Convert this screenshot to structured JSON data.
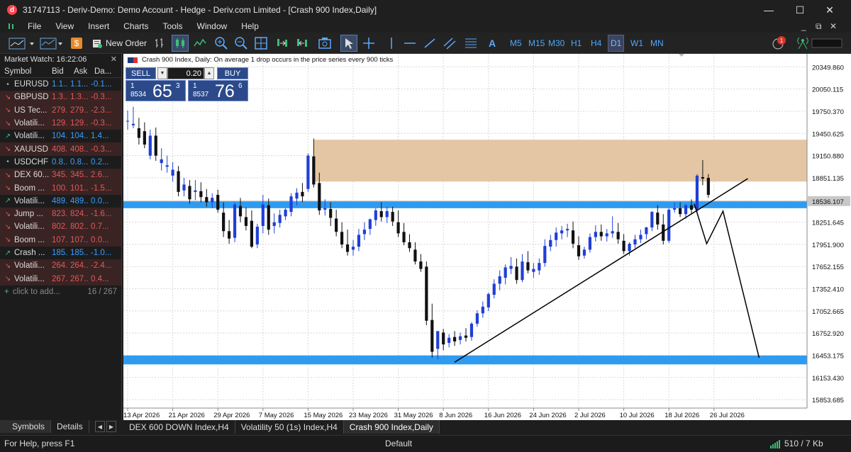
{
  "window": {
    "app_icon": "d",
    "title": "31747113 - Deriv-Demo: Demo Account - Hedge - Deriv.com Limited - [Crash 900 Index,Daily]",
    "minimize": "—",
    "maximize": "☐",
    "close": "✕"
  },
  "menu": {
    "items": [
      "File",
      "View",
      "Insert",
      "Charts",
      "Tools",
      "Window",
      "Help"
    ],
    "right_minimize": "_",
    "right_restore": "⧉",
    "right_close": "✕"
  },
  "toolbar": {
    "new_order": "New Order",
    "timeframes": [
      "M5",
      "M15",
      "M30",
      "H1",
      "H4",
      "D1",
      "W1",
      "MN"
    ],
    "active_timeframe": "D1",
    "notification_count": "1"
  },
  "market_watch": {
    "title": "Market Watch: 16:22:06",
    "close": "✕",
    "headers": {
      "symbol": "Symbol",
      "bid": "Bid",
      "ask": "Ask",
      "daily": "Da..."
    },
    "rows": [
      {
        "symbol": "EURUSD",
        "bid": "1.1...",
        "ask": "1.1...",
        "daily": "-0.1...",
        "trend": "flat"
      },
      {
        "symbol": "GBPUSD",
        "bid": "1.3...",
        "ask": "1.3...",
        "daily": "-0.3...",
        "trend": "down"
      },
      {
        "symbol": "US Tec...",
        "bid": "279...",
        "ask": "279...",
        "daily": "-2.3...",
        "trend": "down"
      },
      {
        "symbol": "Volatili...",
        "bid": "129...",
        "ask": "129...",
        "daily": "-0.3...",
        "trend": "down"
      },
      {
        "symbol": "Volatili...",
        "bid": "104...",
        "ask": "104...",
        "daily": "1.4...",
        "trend": "up"
      },
      {
        "symbol": "XAUUSD",
        "bid": "408...",
        "ask": "408...",
        "daily": "-0.3...",
        "trend": "down"
      },
      {
        "symbol": "USDCHF",
        "bid": "0.8...",
        "ask": "0.8...",
        "daily": "0.2...",
        "trend": "flat"
      },
      {
        "symbol": "DEX 60...",
        "bid": "345...",
        "ask": "345...",
        "daily": "2.6...",
        "trend": "down"
      },
      {
        "symbol": "Boom ...",
        "bid": "100...",
        "ask": "101...",
        "daily": "-1.5...",
        "trend": "down"
      },
      {
        "symbol": "Volatili...",
        "bid": "489...",
        "ask": "489...",
        "daily": "0.0...",
        "trend": "up"
      },
      {
        "symbol": "Jump ...",
        "bid": "823...",
        "ask": "824...",
        "daily": "-1.6...",
        "trend": "down"
      },
      {
        "symbol": "Volatili...",
        "bid": "802...",
        "ask": "802...",
        "daily": "0.7...",
        "trend": "down"
      },
      {
        "symbol": "Boom ...",
        "bid": "107...",
        "ask": "107...",
        "daily": "0.0...",
        "trend": "down"
      },
      {
        "symbol": "Crash ...",
        "bid": "185...",
        "ask": "185...",
        "daily": "-1.0...",
        "trend": "up"
      },
      {
        "symbol": "Volatili...",
        "bid": "264...",
        "ask": "264...",
        "daily": "-2.4...",
        "trend": "down"
      },
      {
        "symbol": "Volatili...",
        "bid": "267...",
        "ask": "267...",
        "daily": "0.4...",
        "trend": "down"
      }
    ],
    "add_label": "click to add...",
    "count": "16 / 267",
    "tabs": [
      "Symbols",
      "Details"
    ]
  },
  "one_click": {
    "sell_label": "SELL",
    "buy_label": "BUY",
    "lot": "0.20",
    "sell_price": {
      "prefix_top": "1",
      "prefix_bottom": "8534",
      "big": "65",
      "sup": "3"
    },
    "buy_price": {
      "prefix_top": "1",
      "prefix_bottom": "8537",
      "big": "76",
      "sup": "6"
    }
  },
  "chart_tabs": [
    "DEX 600 DOWN Index,H4",
    "Volatility 50 (1s) Index,H4",
    "Crash 900 Index,Daily"
  ],
  "active_chart_tab": "Crash 900 Index,Daily",
  "chart_data": {
    "type": "candlestick",
    "title": "Crash 900 Index, Daily:  On average 1 drop occurs in the price series every 900 ticks",
    "y_ticks": [
      "20349.860",
      "20050.115",
      "19750.370",
      "19450.625",
      "19150.880",
      "18851.135",
      "18536.107",
      "18251.645",
      "17951.900",
      "17652.155",
      "17352.410",
      "17052.665",
      "16752.920",
      "16453.175",
      "16153.430",
      "15853.685"
    ],
    "y_tick_values": [
      20349.86,
      20050.115,
      19750.37,
      19450.625,
      19150.88,
      18851.135,
      18536.107,
      18251.645,
      17951.9,
      17652.155,
      17352.41,
      17052.665,
      16752.92,
      16453.175,
      16153.43,
      15853.685
    ],
    "ylim": [
      15740,
      20525
    ],
    "current_price": 18536.107,
    "x_ticks": [
      "13 Apr 2026",
      "21 Apr 2026",
      "29 Apr 2026",
      "7 May 2026",
      "15 May 2026",
      "23 May 2026",
      "31 May 2026",
      "8 Jun 2026",
      "16 Jun 2026",
      "24 Jun 2026",
      "2 Jul 2026",
      "10 Jul 2026",
      "18 Jul 2026",
      "26 Jul 2026"
    ],
    "x_tick_day_index": [
      0,
      8,
      16,
      24,
      32,
      40,
      48,
      56,
      64,
      72,
      80,
      88,
      96,
      104
    ],
    "x_days_total": 120,
    "grid": true,
    "colors": {
      "bull": "#1f3fd6",
      "bear": "#111111",
      "zone": "#e5c6a4",
      "level": "#2f9bf0",
      "current_price_line": "#bcbcbc"
    },
    "supply_zone": {
      "from_day": 33,
      "to_day": 120,
      "top": 19365,
      "bottom": 18800
    },
    "support_levels": [
      {
        "label": "upper",
        "top": 18535,
        "bottom": 18440
      },
      {
        "label": "lower",
        "top": 16450,
        "bottom": 16330
      }
    ],
    "trendline": {
      "from_day": 58,
      "from_price": 16360,
      "to_day": 110,
      "to_price": 18840
    },
    "projection_path": [
      {
        "day": 100.5,
        "price": 18500
      },
      {
        "day": 102.7,
        "price": 17960
      },
      {
        "day": 105.6,
        "price": 18400
      },
      {
        "day": 112,
        "price": 16420
      }
    ],
    "candles": [
      [
        19610,
        19760,
        19620,
        19500
      ],
      [
        19560,
        19810,
        19580,
        19520
      ],
      [
        19520,
        19660,
        19390,
        19300
      ],
      [
        19480,
        19600,
        19300,
        19250
      ],
      [
        19150,
        19500,
        19420,
        19100
      ],
      [
        19420,
        19530,
        19150,
        19080
      ],
      [
        19050,
        19250,
        19100,
        18950
      ],
      [
        19000,
        19150,
        19020,
        18920
      ],
      [
        18880,
        19060,
        18960,
        18800
      ],
      [
        18940,
        19010,
        18660,
        18600
      ],
      [
        18680,
        18850,
        18760,
        18600
      ],
      [
        18740,
        18820,
        18560,
        18500
      ],
      [
        18660,
        18820,
        18680,
        18550
      ],
      [
        18670,
        18790,
        18590,
        18520
      ],
      [
        18590,
        18700,
        18520,
        18460
      ],
      [
        18520,
        18640,
        18580,
        18440
      ],
      [
        18620,
        18690,
        18420,
        18380
      ],
      [
        18380,
        18520,
        18130,
        18050
      ],
      [
        18130,
        18280,
        18030,
        17960
      ],
      [
        18040,
        18520,
        18490,
        17980
      ],
      [
        18470,
        18580,
        18330,
        18250
      ],
      [
        18320,
        18450,
        18200,
        18140
      ],
      [
        18270,
        18410,
        17920,
        17900
      ],
      [
        17950,
        18230,
        18190,
        17900
      ],
      [
        18200,
        18620,
        18490,
        18100
      ],
      [
        18480,
        18570,
        18150,
        18080
      ],
      [
        18200,
        18370,
        18250,
        18100
      ],
      [
        18240,
        18420,
        18350,
        18180
      ],
      [
        18330,
        18440,
        18420,
        18280
      ],
      [
        18390,
        18640,
        18600,
        18330
      ],
      [
        18570,
        18710,
        18650,
        18480
      ],
      [
        18660,
        18780,
        18600,
        18520
      ],
      [
        18700,
        19180,
        19150,
        18660
      ],
      [
        19140,
        19380,
        18760,
        18720
      ],
      [
        18780,
        18920,
        18410,
        18350
      ],
      [
        18420,
        18560,
        18440,
        18340
      ],
      [
        18430,
        18520,
        18310,
        18200
      ],
      [
        18300,
        18420,
        18120,
        18060
      ],
      [
        18120,
        18250,
        17950,
        17900
      ],
      [
        17950,
        18150,
        17850,
        17800
      ],
      [
        17880,
        18010,
        17920,
        17800
      ],
      [
        17920,
        18160,
        18080,
        17860
      ],
      [
        18090,
        18250,
        18150,
        18010
      ],
      [
        18160,
        18300,
        18290,
        18080
      ],
      [
        18280,
        18440,
        18410,
        18200
      ],
      [
        18400,
        18520,
        18320,
        18260
      ],
      [
        18320,
        18460,
        18400,
        18240
      ],
      [
        18390,
        18460,
        18260,
        18200
      ],
      [
        18250,
        18410,
        18100,
        18050
      ],
      [
        18120,
        18240,
        17980,
        17940
      ],
      [
        17980,
        18090,
        17900,
        17850
      ],
      [
        17880,
        17980,
        17720,
        17680
      ],
      [
        17720,
        17820,
        17620,
        17580
      ],
      [
        17650,
        17720,
        16920,
        16860
      ],
      [
        16930,
        17150,
        16500,
        16420
      ],
      [
        16540,
        16760,
        16780,
        16400
      ],
      [
        16760,
        16810,
        16600,
        16520
      ],
      [
        16620,
        16740,
        16690,
        16560
      ],
      [
        16700,
        16780,
        16640,
        16580
      ],
      [
        16660,
        16760,
        16710,
        16600
      ],
      [
        16720,
        16820,
        16690,
        16640
      ],
      [
        16700,
        16900,
        16880,
        16650
      ],
      [
        16880,
        17060,
        17020,
        16840
      ],
      [
        17020,
        17180,
        17110,
        16960
      ],
      [
        17100,
        17300,
        17280,
        17050
      ],
      [
        17270,
        17480,
        17420,
        17220
      ],
      [
        17420,
        17600,
        17520,
        17330
      ],
      [
        17500,
        17680,
        17640,
        17410
      ],
      [
        17620,
        17780,
        17660,
        17550
      ],
      [
        17650,
        17760,
        17470,
        17420
      ],
      [
        17470,
        17820,
        17720,
        17440
      ],
      [
        17710,
        17860,
        17600,
        17560
      ],
      [
        17580,
        17700,
        17620,
        17500
      ],
      [
        17600,
        17760,
        17700,
        17540
      ],
      [
        17700,
        18020,
        17930,
        17650
      ],
      [
        17920,
        18080,
        18010,
        17860
      ],
      [
        18010,
        18180,
        18110,
        17920
      ],
      [
        18100,
        18200,
        18140,
        18020
      ],
      [
        18140,
        18230,
        18160,
        18050
      ],
      [
        18140,
        18260,
        17960,
        17900
      ],
      [
        17940,
        18060,
        17790,
        17740
      ],
      [
        17800,
        17920,
        17880,
        17760
      ],
      [
        17880,
        18100,
        18050,
        17840
      ],
      [
        18050,
        18210,
        18120,
        17990
      ],
      [
        18120,
        18220,
        18060,
        18000
      ],
      [
        18060,
        18160,
        18100,
        17990
      ],
      [
        18100,
        18330,
        18130,
        18040
      ],
      [
        18120,
        18240,
        18020,
        17960
      ],
      [
        18000,
        18090,
        17860,
        17820
      ],
      [
        17860,
        17980,
        17960,
        17800
      ],
      [
        17950,
        18080,
        18020,
        17900
      ],
      [
        18020,
        18150,
        18080,
        17970
      ],
      [
        18090,
        18190,
        18180,
        18020
      ],
      [
        18180,
        18400,
        18390,
        18130
      ],
      [
        18380,
        18480,
        18220,
        18150
      ],
      [
        18220,
        18360,
        18000,
        17950
      ],
      [
        18000,
        18440,
        18420,
        17970
      ],
      [
        18420,
        18520,
        18440,
        18380
      ],
      [
        18440,
        18520,
        18360,
        18320
      ],
      [
        18360,
        18500,
        18480,
        18300
      ],
      [
        18480,
        18560,
        18420,
        18360
      ],
      [
        18420,
        18900,
        18880,
        18390
      ],
      [
        18860,
        19090,
        18840,
        18750
      ],
      [
        18850,
        18900,
        18620,
        18580
      ]
    ]
  }
}
